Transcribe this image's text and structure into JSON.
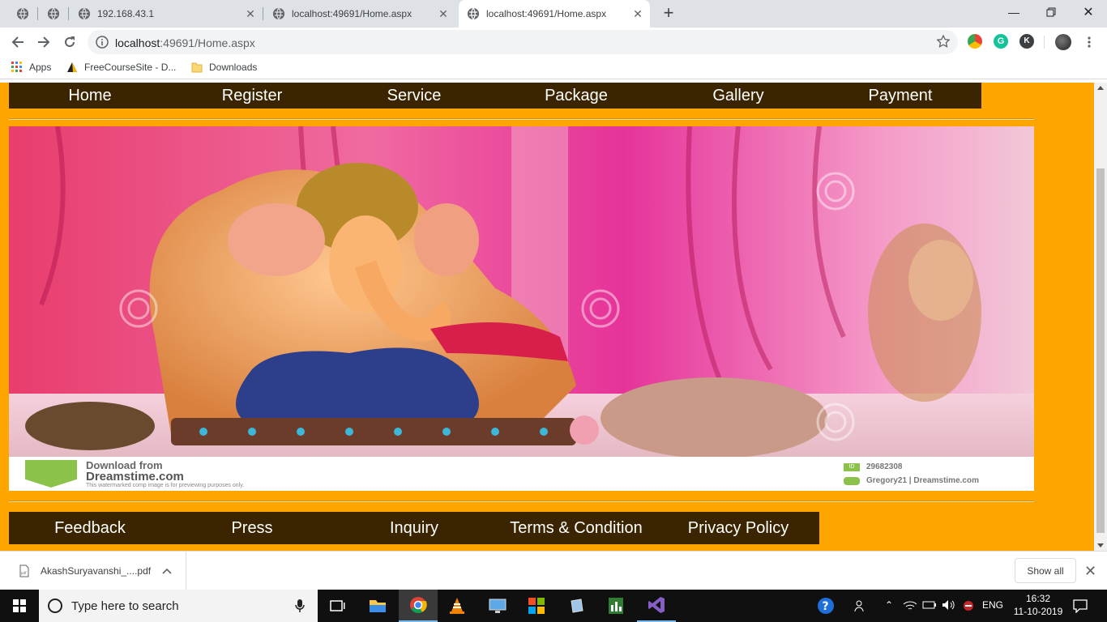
{
  "browser": {
    "tabs": [
      {
        "title": "",
        "active": false
      },
      {
        "title": "",
        "active": false
      },
      {
        "title": "192.168.43.1",
        "active": false
      },
      {
        "title": "localhost:49691/Home.aspx",
        "active": false
      },
      {
        "title": "localhost:49691/Home.aspx",
        "active": true
      }
    ],
    "url_host": "localhost",
    "url_rest": ":49691/Home.aspx",
    "bookmarks": {
      "apps": "Apps",
      "freecourse": "FreeCourseSite - D...",
      "downloads": "Downloads"
    },
    "profile_letters": {
      "grammarly": "G",
      "k": "K"
    }
  },
  "page": {
    "colors": {
      "background": "#ffa500",
      "menu_bg": "#3a2500",
      "menu_text": "#ffffff"
    },
    "top_menu": [
      "Home",
      "Register",
      "Service",
      "Package",
      "Gallery",
      "Payment"
    ],
    "hero_watermark": {
      "line1": "Download from",
      "line2": "Dreamstime.com",
      "line3": "This watermarked comp image is for previewing purposes only.",
      "id_label": "ID",
      "id_value": "29682308",
      "credit": "Gregory21 | Dreamstime.com"
    },
    "footer_menu": [
      "Feedback",
      "Press",
      "Inquiry",
      "Terms & Condition",
      "Privacy Policy"
    ]
  },
  "downloads_bar": {
    "file": "AkashSuryavanshi_....pdf",
    "show_all": "Show all"
  },
  "taskbar": {
    "search_placeholder": "Type here to search",
    "lang": "ENG",
    "time": "16:32",
    "date": "11-10-2019"
  }
}
